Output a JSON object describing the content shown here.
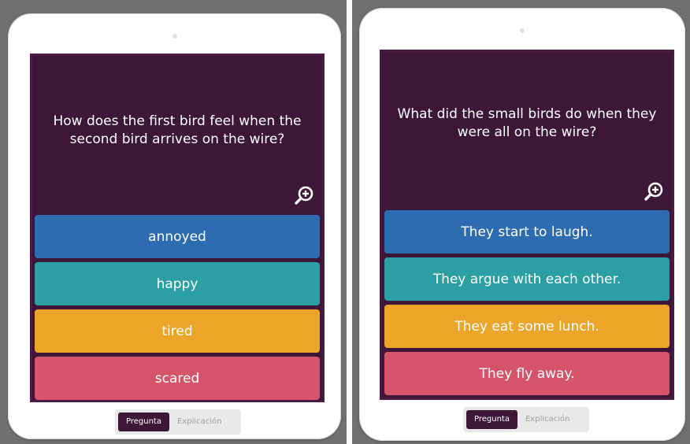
{
  "colors": {
    "card_background": "#3d1737",
    "answer_blue": "#2e6cb2",
    "answer_teal": "#2b9fa3",
    "answer_yellow": "#eba62a",
    "answer_red": "#d5546a"
  },
  "cards": [
    {
      "question": "How does the first bird feel when the second bird arrives on the wire?",
      "answers": [
        "annoyed",
        "happy",
        "tired",
        "scared"
      ],
      "tabs": {
        "question": "Pregunta",
        "explanation": "Explicación"
      }
    },
    {
      "question": "What did the small birds do when they were all on the wire?",
      "answers": [
        "They start to laugh.",
        "They argue with each other.",
        "They eat some lunch.",
        "They fly away."
      ],
      "tabs": {
        "question": "Pregunta",
        "explanation": "Explicación"
      }
    }
  ]
}
